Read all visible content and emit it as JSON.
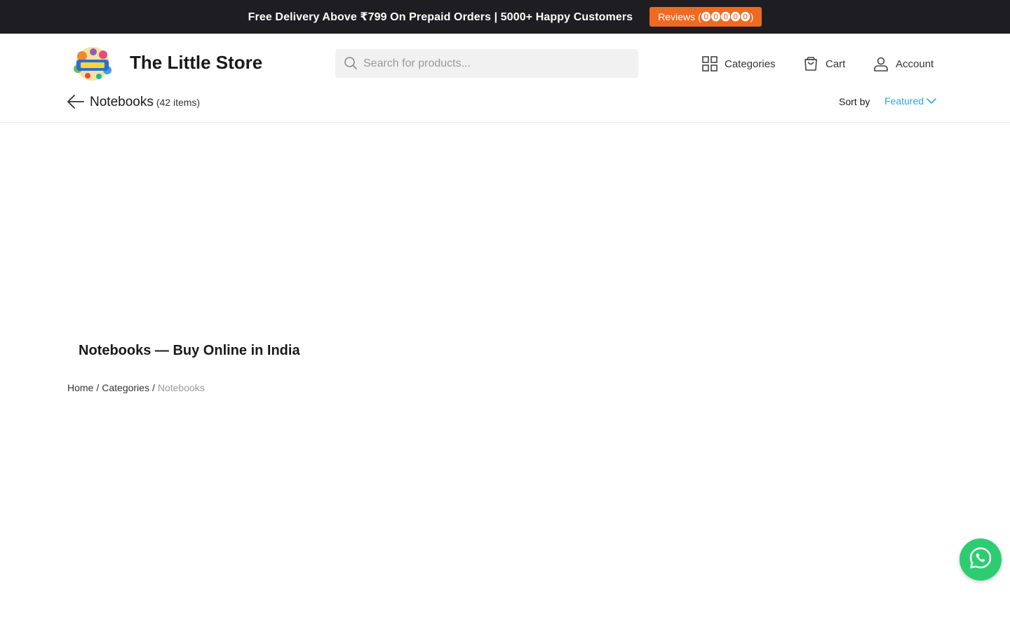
{
  "promo": {
    "text": "Free Delivery Above ₹799 On Prepaid Orders | 5000+ Happy Customers",
    "reviews_label": "Reviews (⓿⓿⓿⓿⓿)"
  },
  "header": {
    "store_name": "The Little Store",
    "search_placeholder": "Search for products...",
    "nav": {
      "categories": "Categories",
      "cart": "Cart",
      "account": "Account"
    },
    "icons": [
      "search-icon",
      "grid-icon",
      "bag-icon",
      "user-icon"
    ]
  },
  "listing": {
    "title": "Notebooks",
    "count": "(42 items)",
    "sort_label": "Sort by",
    "sort_value": "Featured"
  },
  "content": {
    "heading": "Notebooks — Buy Online in India"
  },
  "breadcrumb": {
    "items": [
      "Home",
      "Categories"
    ],
    "current": "Notebooks"
  },
  "colors": {
    "promo_bg": "#1e1e22",
    "reviews_btn": "#ee6a22",
    "sort_accent": "#2aa7de",
    "whatsapp": "#2ecc71"
  }
}
